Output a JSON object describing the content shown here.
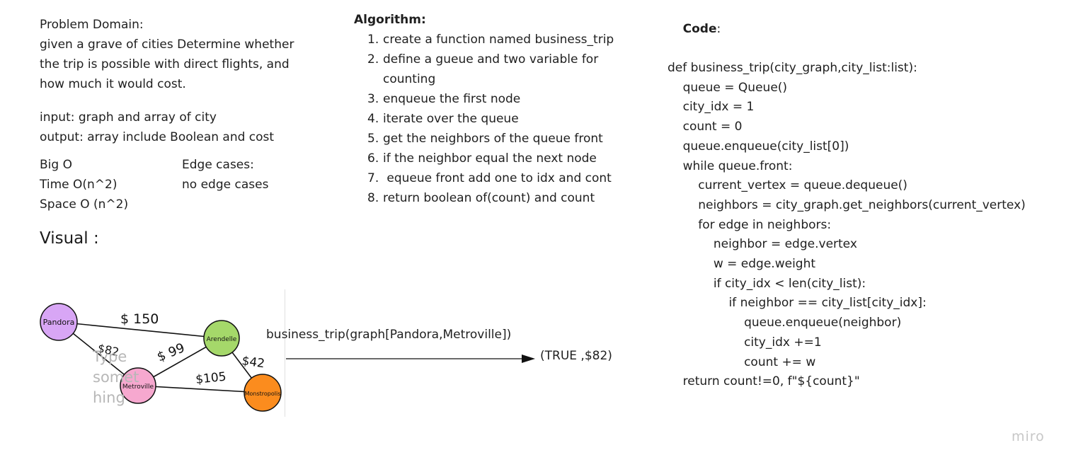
{
  "problem": {
    "title": "Problem Domain:",
    "lines": [
      "given a grave of cities Determine whether",
      "the trip is possible with direct flights, and",
      "how much it would cost."
    ],
    "input": "input: graph and array of city",
    "output": "output: array include Boolean and cost",
    "bigo_title": "Big O",
    "time": "Time O(n^2)",
    "space": "Space O (n^2)",
    "edge_title": "Edge cases:",
    "edge_text": "no edge cases"
  },
  "visual": {
    "heading": "Visual :",
    "call_text": "business_trip(graph[Pandora,Metroville])",
    "result_text": "(TRUE ,$82)",
    "placeholder_lines": [
      "Type",
      "somet",
      "hing"
    ],
    "nodes": [
      {
        "label": "Pandora",
        "color": "#d8a6f5"
      },
      {
        "label": "Arendelle",
        "color": "#a5d86a"
      },
      {
        "label": "Metroville",
        "color": "#f6a8cf"
      },
      {
        "label": "Monstropolis",
        "color": "#fb8c1e"
      }
    ],
    "edges": [
      {
        "label": "$ 150"
      },
      {
        "label": "$82"
      },
      {
        "label": "$ 99"
      },
      {
        "label": "$42"
      },
      {
        "label": "$105"
      }
    ]
  },
  "algorithm": {
    "title": "Algorithm:",
    "steps": [
      {
        "num": "1.",
        "text": "create a function named business_trip"
      },
      {
        "num": "2.",
        "text": "define a gueue and two variable for counting"
      },
      {
        "num": "3.",
        "text": "enqueue the first node"
      },
      {
        "num": "4.",
        "text": "iterate over the queue"
      },
      {
        "num": "5.",
        "text": "get the neighbors of the queue front"
      },
      {
        "num": "6.",
        "text": "if the neighbor equal the next node"
      },
      {
        "num": "7.",
        "text": " equeue front add one to idx and cont"
      },
      {
        "num": "8.",
        "text": "return boolean of(count) and count"
      }
    ]
  },
  "code": {
    "title": "Code",
    "title_suffix": ":",
    "lines": [
      "def business_trip(city_graph,city_list:list):",
      "    queue = Queue()",
      "    city_idx = 1",
      "    count = 0",
      "    queue.enqueue(city_list[0])",
      "    while queue.front:",
      "        current_vertex = queue.dequeue()",
      "        neighbors = city_graph.get_neighbors(current_vertex)",
      "        for edge in neighbors:",
      "            neighbor = edge.vertex",
      "            w = edge.weight",
      "            if city_idx < len(city_list):",
      "                if neighbor == city_list[city_idx]:",
      "                    queue.enqueue(neighbor)",
      "                    city_idx +=1",
      "                    count += w",
      "    return count!=0, f\"${count}\""
    ]
  },
  "brand": {
    "logo": "miro"
  }
}
